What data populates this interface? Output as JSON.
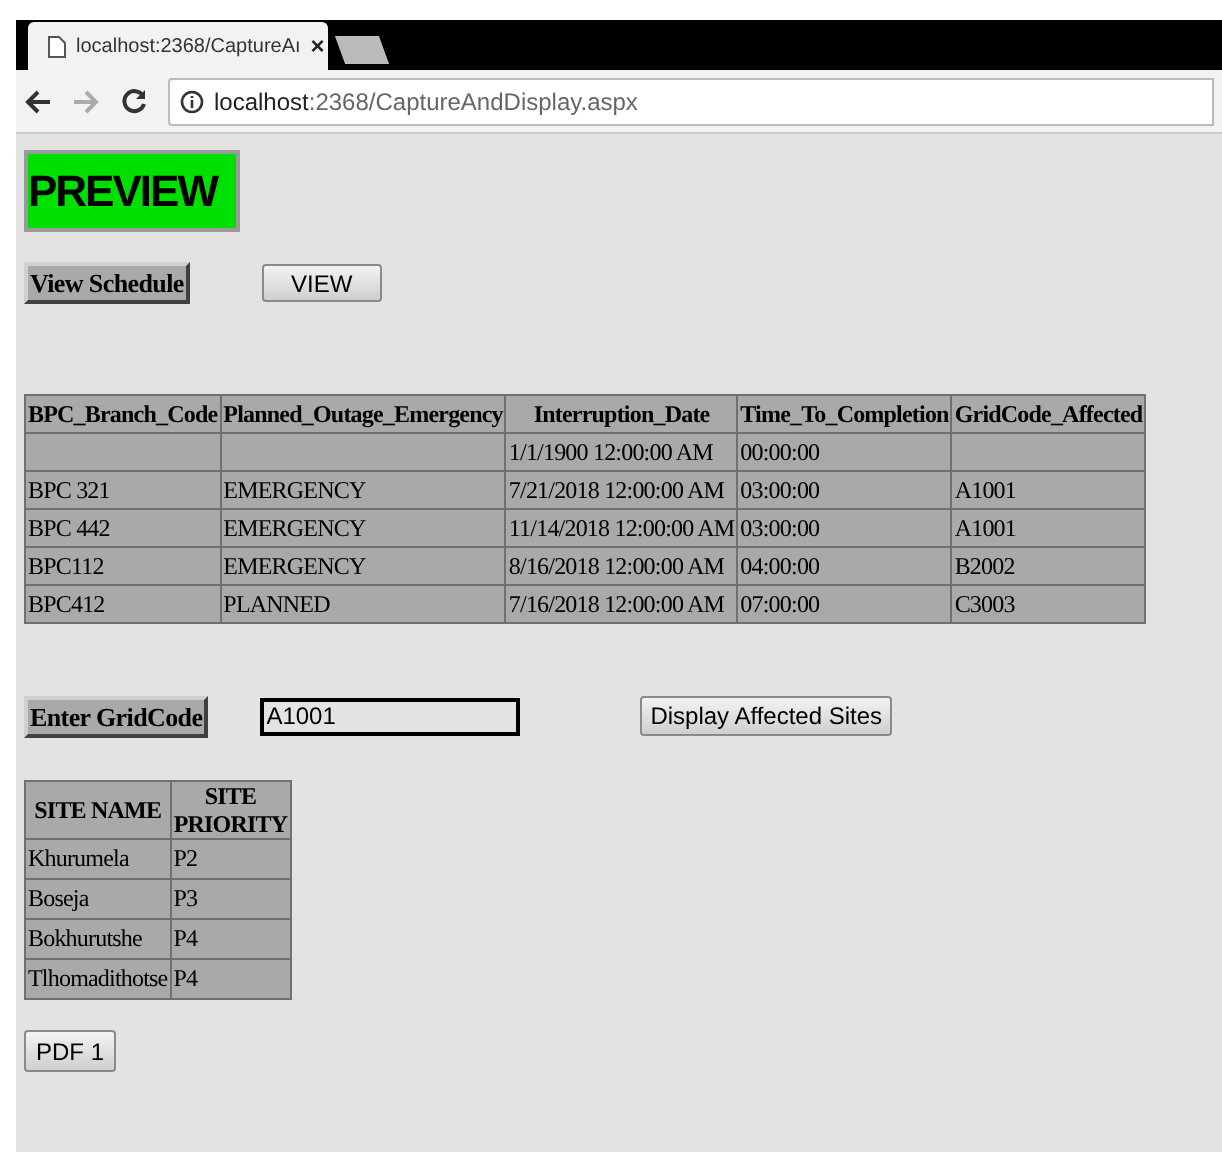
{
  "browser": {
    "tab_title": "localhost:2368/CaptureAı",
    "tab_close": "×",
    "address_host": "localhost",
    "address_path": ":2368/CaptureAndDisplay.aspx"
  },
  "page": {
    "heading": "PREVIEW",
    "schedule_label": "View Schedule",
    "view_button": "VIEW",
    "schedule_table": {
      "columns": [
        "BPC_Branch_Code",
        "Planned_Outage_Emergency",
        "Interruption_Date",
        "Time_To_Completion",
        "GridCode_Affected"
      ],
      "rows": [
        [
          "",
          "",
          "1/1/1900 12:00:00 AM",
          "00:00:00",
          ""
        ],
        [
          "BPC 321",
          "EMERGENCY",
          "7/21/2018 12:00:00 AM",
          "03:00:00",
          "A1001"
        ],
        [
          "BPC 442",
          "EMERGENCY",
          "11/14/2018 12:00:00 AM",
          "03:00:00",
          "A1001"
        ],
        [
          "BPC112",
          "EMERGENCY",
          "8/16/2018 12:00:00 AM",
          "04:00:00",
          "B2002"
        ],
        [
          "BPC412",
          "PLANNED",
          "7/16/2018 12:00:00 AM",
          "07:00:00",
          "C3003"
        ]
      ]
    },
    "gridcode_label": "Enter GridCode",
    "gridcode_field": {
      "value": "A1001"
    },
    "display_button": "Display Affected Sites",
    "sites_table": {
      "columns": [
        "SITE NAME",
        "SITE PRIORITY"
      ],
      "rows": [
        [
          "Khurumela",
          "P2"
        ],
        [
          "Boseja",
          "P3"
        ],
        [
          "Bokhurutshe",
          "P4"
        ],
        [
          "Tlhomadithotse",
          "P4"
        ]
      ]
    },
    "pdf_button": "PDF 1"
  }
}
